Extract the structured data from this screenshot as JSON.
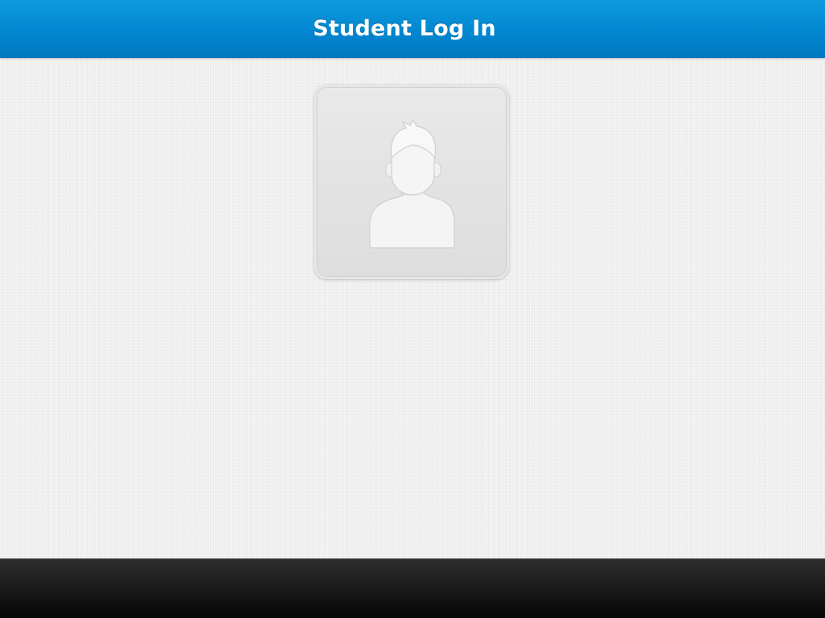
{
  "header": {
    "title": "Student Log In"
  },
  "student_tiles": [
    {
      "icon": "user-avatar-icon"
    }
  ],
  "colors": {
    "header_blue": "#0288d1",
    "background": "#f2f2f2",
    "footer": "#1a1a1a"
  }
}
